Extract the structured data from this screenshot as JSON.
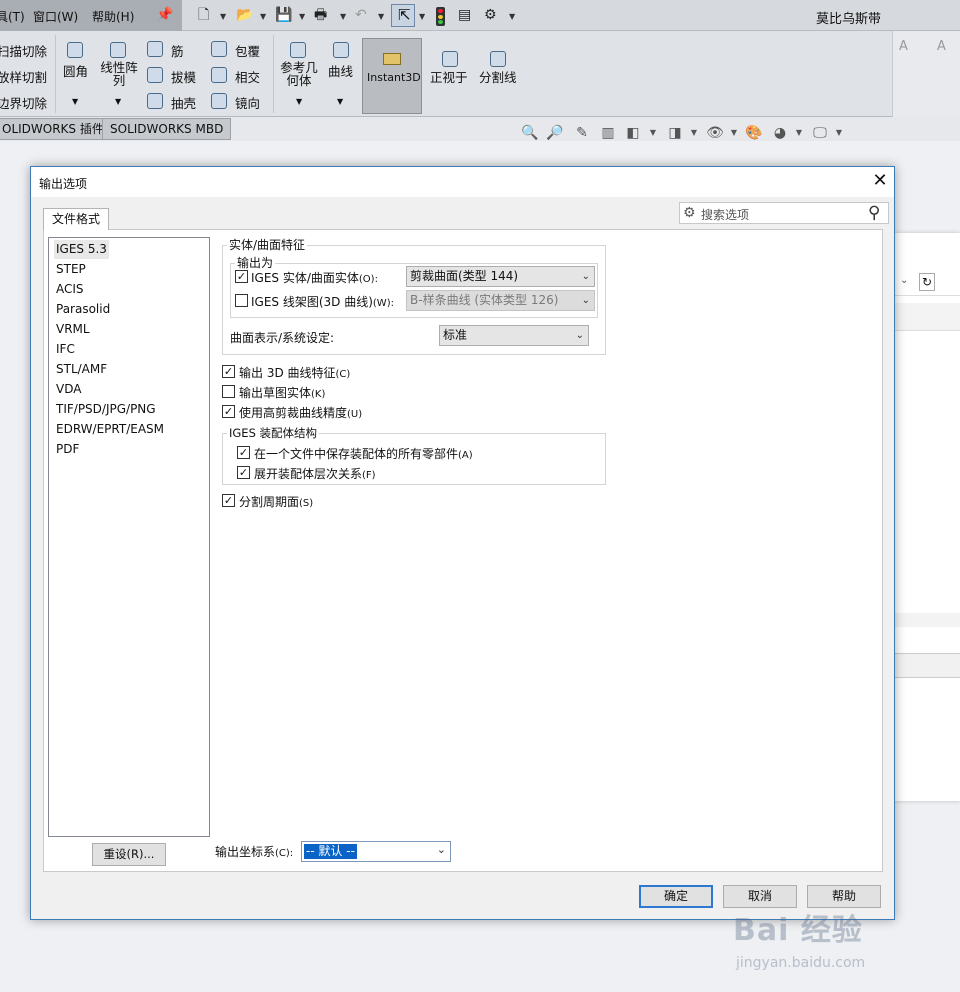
{
  "menubar": {
    "items": [
      "具(T)",
      "窗口(W)",
      "帮助(H)"
    ],
    "app_title": "莫比乌斯带"
  },
  "ribbon": {
    "left_cut": [
      "扫描切除",
      "放样切割",
      "边界切除"
    ],
    "fillet": "圆角",
    "pattern": "线性阵列",
    "rib": "筋",
    "draft": "拔模",
    "shell": "抽壳",
    "wrap": "包覆",
    "intersect": "相交",
    "mirror": "镜向",
    "refgeom": "参考几何体",
    "curves": "曲线",
    "instant3d": "Instant3D",
    "normal_to": "正视于",
    "split_line": "分割线"
  },
  "tabs": {
    "addins": "OLIDWORKS 插件",
    "mbd": "SOLIDWORKS MBD"
  },
  "dialog": {
    "title": "输出选项",
    "file_format_tab": "文件格式",
    "search_placeholder": "搜索选项",
    "formats": [
      "IGES 5.3",
      "STEP",
      "ACIS",
      "Parasolid",
      "VRML",
      "IFC",
      "STL/AMF",
      "VDA",
      "TIF/PSD/JPG/PNG",
      "EDRW/EPRT/EASM",
      "PDF"
    ],
    "selected_format": "IGES 5.3",
    "reset_button": "重设(R)...",
    "solid_group": "实体/曲面特征",
    "output_as": "输出为",
    "iges_solid": {
      "label": "IGES 实体/曲面实体",
      "key": "(O):",
      "checked": true,
      "value": "剪裁曲面(类型 144)"
    },
    "iges_wire": {
      "label": "IGES 线架图(3D 曲线)",
      "key": "(W):",
      "checked": false,
      "value": "B-样条曲线 (实体类型 126)"
    },
    "surface_rep": {
      "label": "曲面表示/系统设定:",
      "value": "标准"
    },
    "opt_3d_curves": {
      "label": "输出 3D 曲线特征",
      "key": "(C)",
      "checked": true
    },
    "opt_sketch": {
      "label": "输出草图实体",
      "key": "(K)",
      "checked": false
    },
    "opt_hiprec": {
      "label": "使用高剪裁曲线精度",
      "key": "(U)",
      "checked": true
    },
    "asm_group": "IGES 装配体结构",
    "opt_save_all": {
      "label": "在一个文件中保存装配体的所有零部件",
      "key": "(A)",
      "checked": true
    },
    "opt_flatten": {
      "label": "展开装配体层次关系",
      "key": "(F)",
      "checked": true
    },
    "opt_split": {
      "label": "分割周期面",
      "key": "(S)",
      "checked": true
    },
    "coord_label": "输出坐标系",
    "coord_key": "(C):",
    "coord_value": "-- 默认 --",
    "ok": "确定",
    "cancel": "取消",
    "help": "帮助"
  },
  "watermark": {
    "brand": "Bai  经验",
    "url": "jingyan.baidu.com"
  }
}
